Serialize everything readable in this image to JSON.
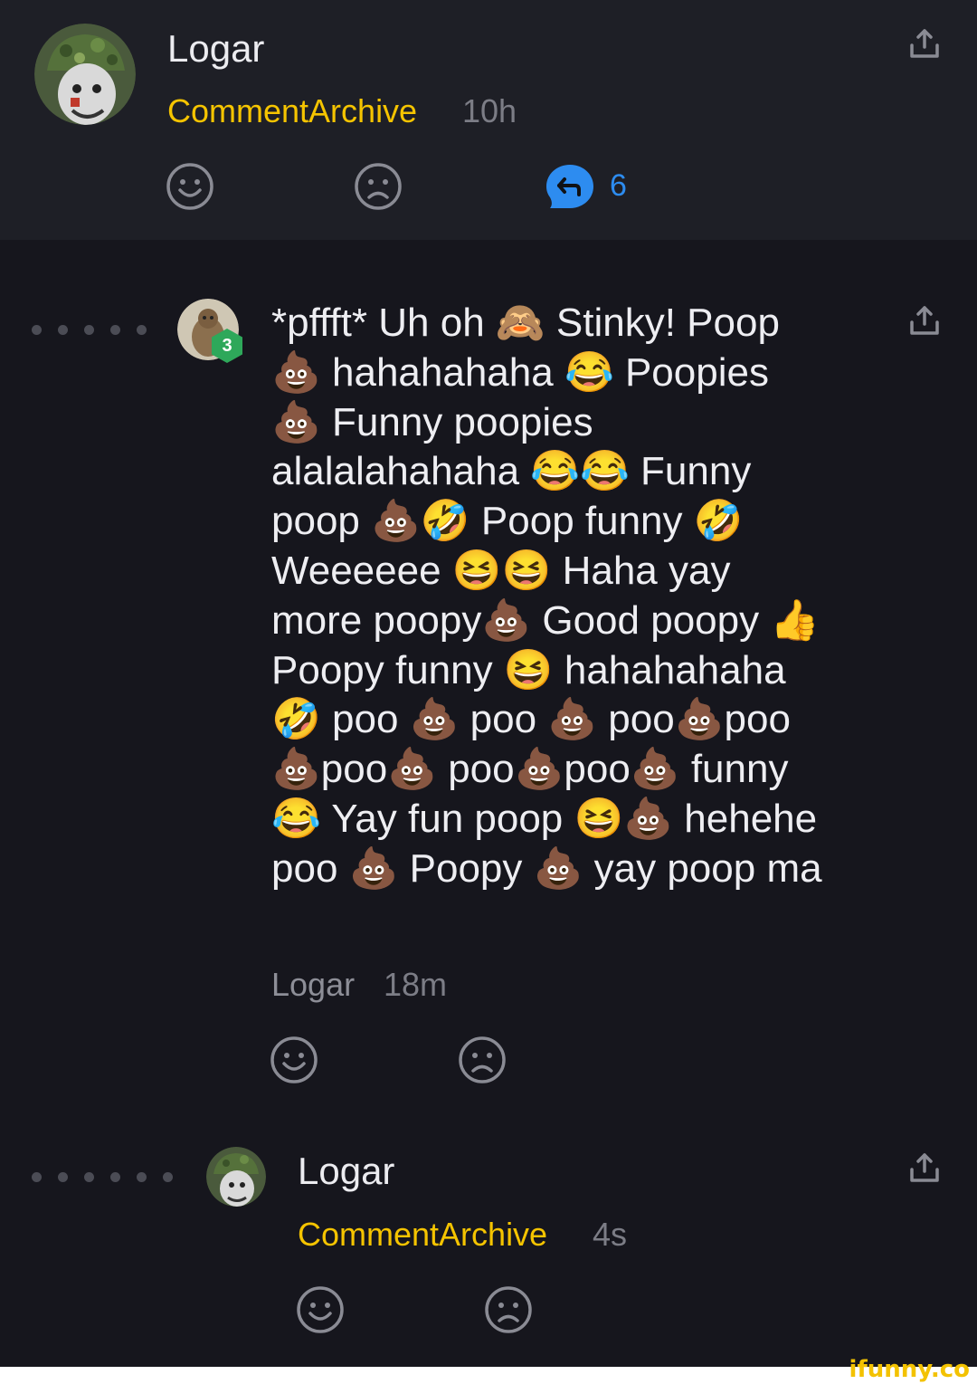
{
  "post": {
    "username": "Logar",
    "archive": "CommentArchive",
    "time": "10h",
    "reply_count": "6"
  },
  "reply": {
    "level": "3",
    "text": "*pffft* Uh oh 🙈 Stinky! Poop 💩 hahahahaha 😂 Poopies 💩 Funny poopies alalalahahaha 😂😂 Funny poop 💩🤣 Poop funny 🤣 Weeeeee 😆😆 Haha yay more poopy💩 Good poopy 👍 Poopy funny 😆 hahahahaha 🤣 poo 💩 poo 💩 poo💩poo💩poo💩 poo💩poo💩 funny 😂 Yay fun poop 😆💩 hehehe poo 💩 Poopy 💩 yay poop ma",
    "author": "Logar",
    "time": "18m"
  },
  "nested": {
    "username": "Logar",
    "archive": "CommentArchive",
    "time": "4s"
  },
  "watermark": "ifunny.co",
  "colors": {
    "accent_yellow": "#f5c400",
    "reply_blue": "#2d8cf0",
    "badge_green": "#2ea85a",
    "background": "#16161d"
  },
  "icons": {
    "share": "share-icon",
    "smile": "smile-icon",
    "frown": "frown-icon",
    "reply": "reply-bubble-icon"
  }
}
